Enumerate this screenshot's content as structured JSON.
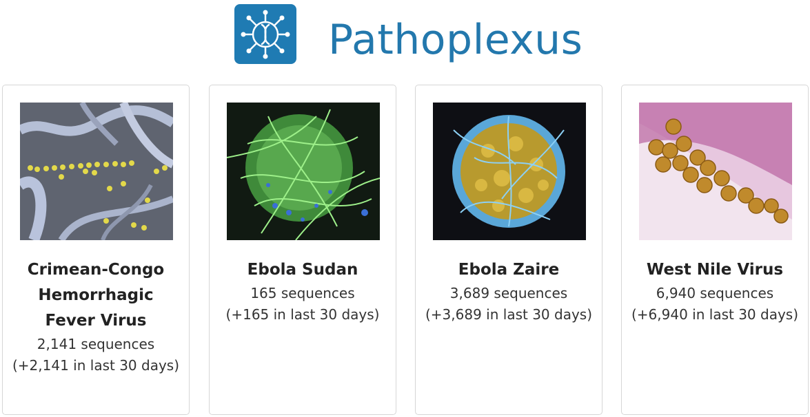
{
  "brand": {
    "name": "Pathoplexus",
    "logo_icon": "dna-virus-icon",
    "color": "#2378ad"
  },
  "organisms": [
    {
      "name": "Crimean-Congo Hemorrhagic Fever Virus",
      "count": "2,141 sequences",
      "recent": "(+2,141 in last 30 days)",
      "image": "cchf-virus-micrograph"
    },
    {
      "name": "Ebola Sudan",
      "count": "165 sequences",
      "recent": "(+165 in last 30 days)",
      "image": "ebola-sudan-micrograph"
    },
    {
      "name": "Ebola Zaire",
      "count": "3,689 sequences",
      "recent": "(+3,689 in last 30 days)",
      "image": "ebola-zaire-micrograph"
    },
    {
      "name": "West Nile Virus",
      "count": "6,940 sequences",
      "recent": "(+6,940 in last 30 days)",
      "image": "west-nile-virus-micrograph"
    }
  ]
}
